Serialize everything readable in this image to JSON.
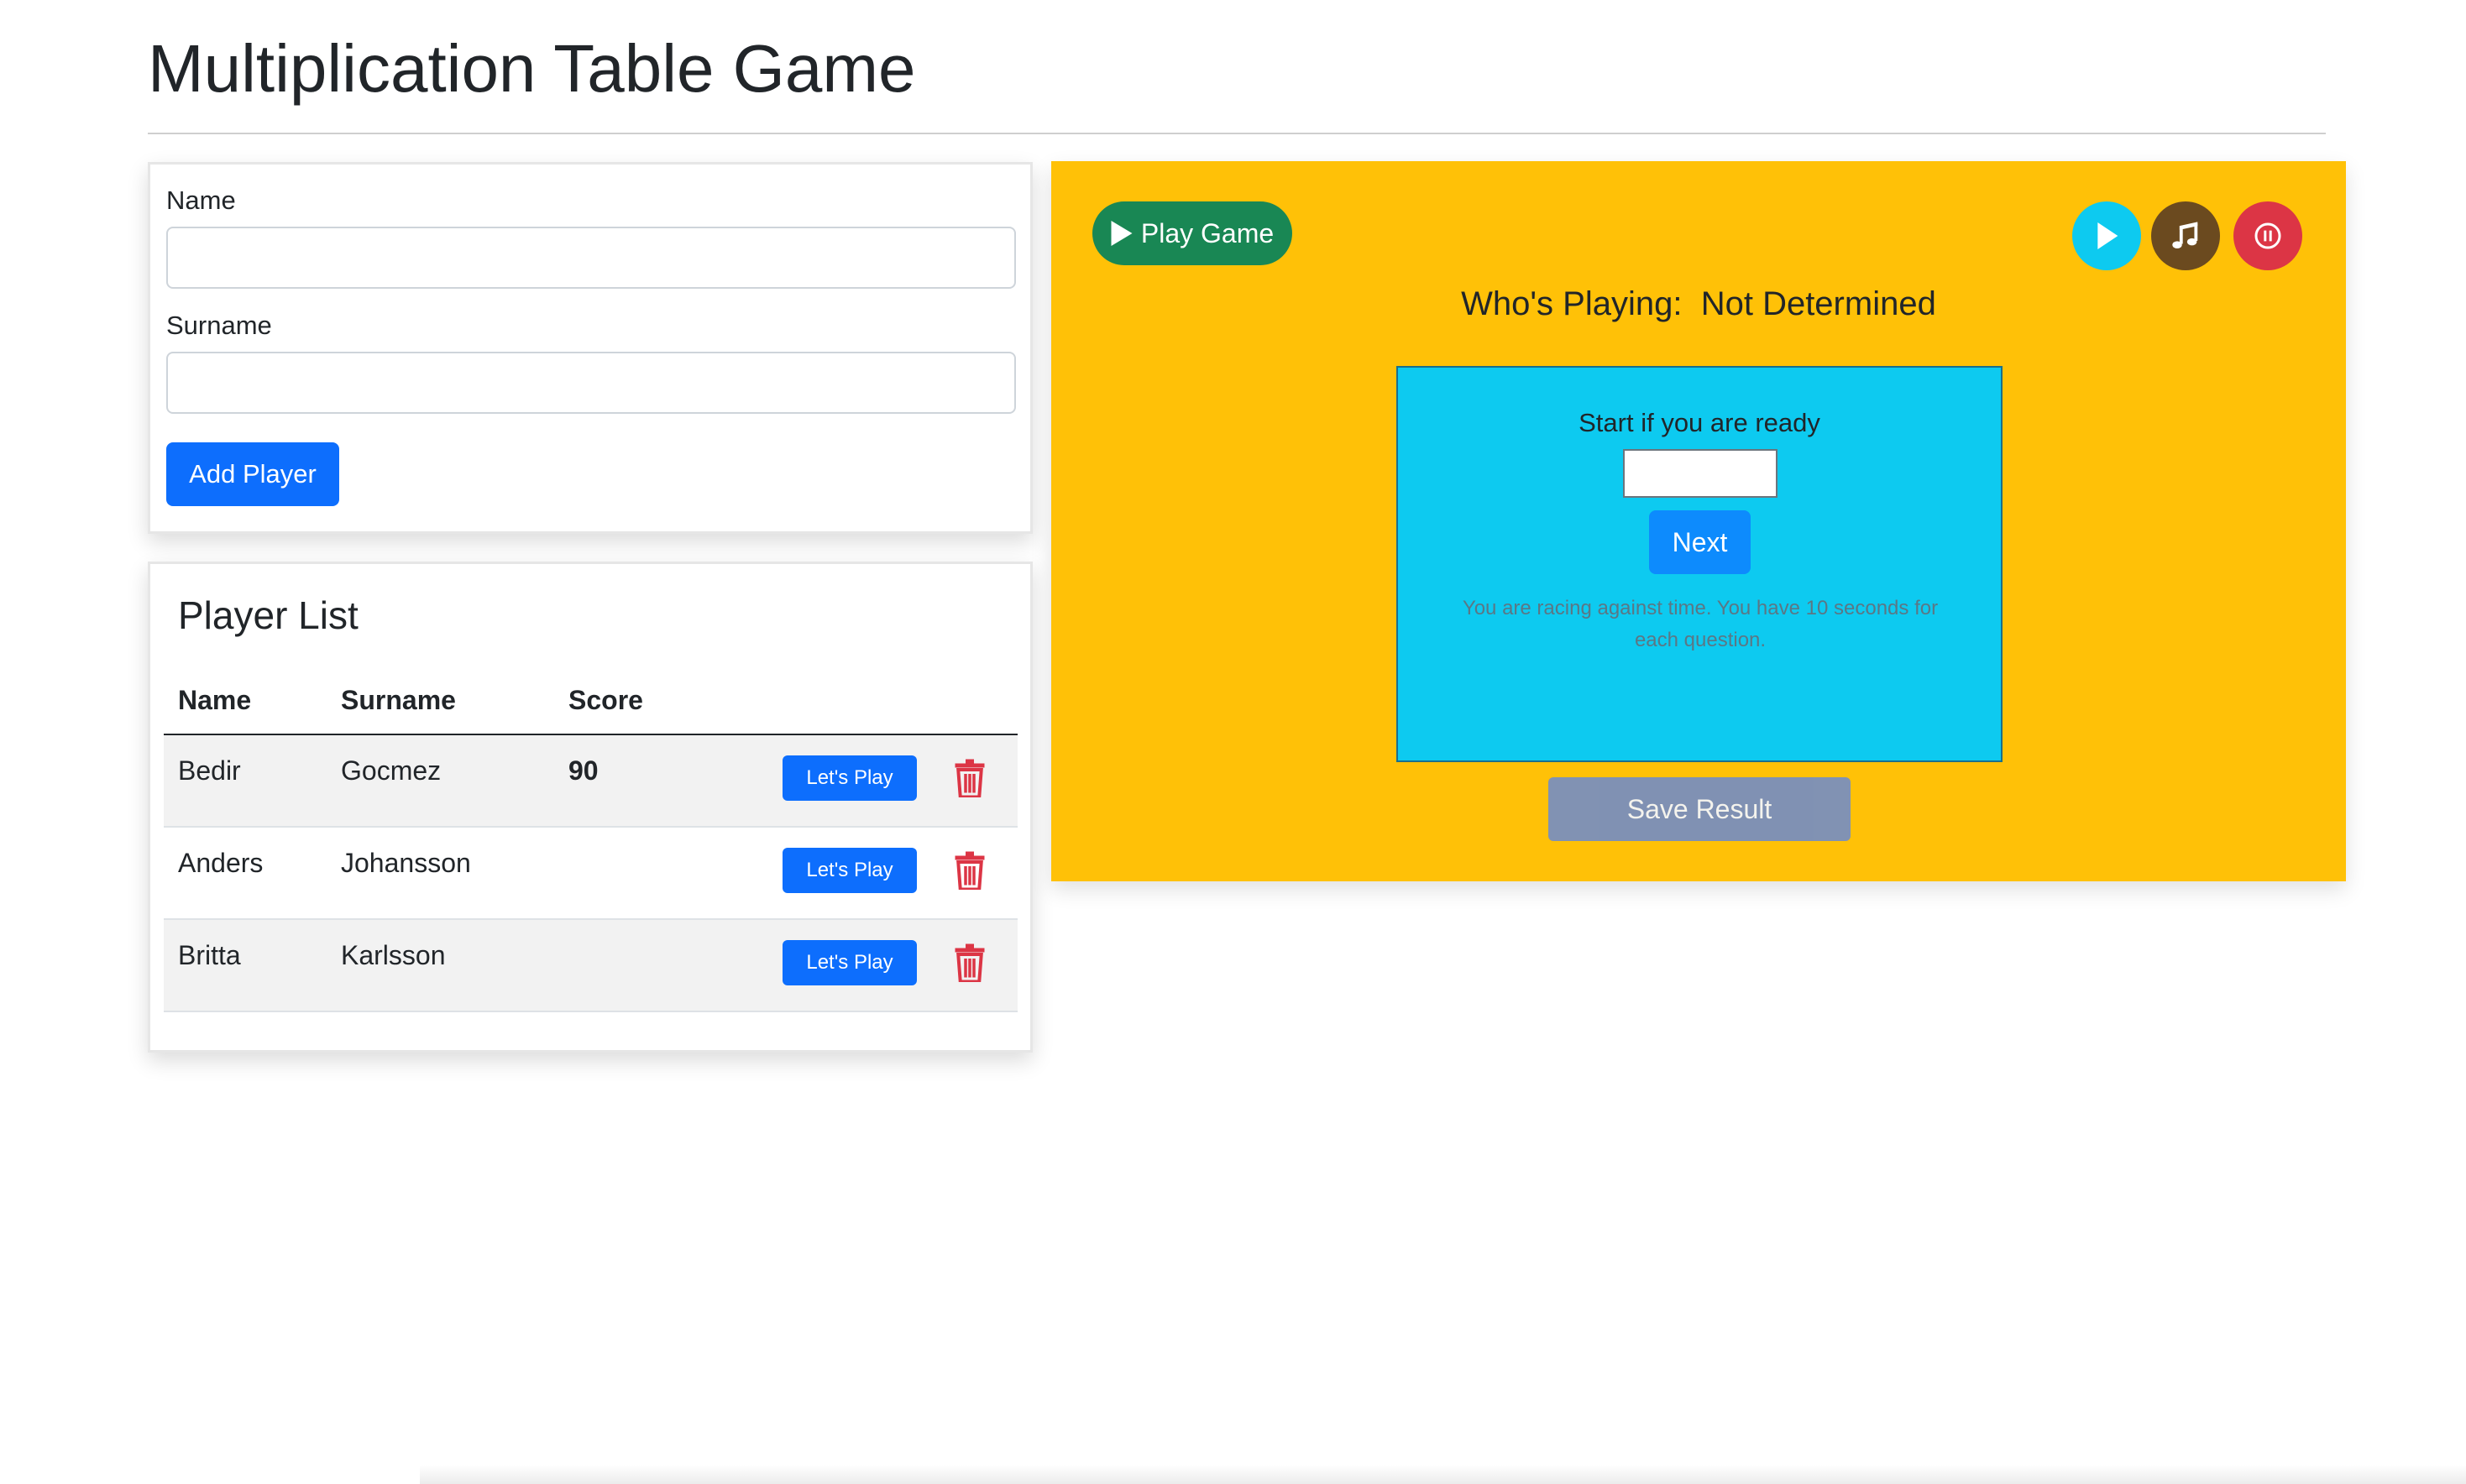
{
  "page": {
    "title": "Multiplication Table Game"
  },
  "form": {
    "name_label": "Name",
    "name_value": "",
    "surname_label": "Surname",
    "surname_value": "",
    "add_button": "Add Player"
  },
  "player_list": {
    "title": "Player List",
    "columns": [
      "Name",
      "Surname",
      "Score"
    ],
    "rows": [
      {
        "name": "Bedir",
        "surname": "Gocmez",
        "score": "90",
        "play_label": "Let's Play"
      },
      {
        "name": "Anders",
        "surname": "Johansson",
        "score": "",
        "play_label": "Let's Play"
      },
      {
        "name": "Britta",
        "surname": "Karlsson",
        "score": "",
        "play_label": "Let's Play"
      }
    ]
  },
  "game": {
    "play_button": "Play Game",
    "playing_label": "Who's Playing:",
    "playing_value": "Not Determined",
    "prompt": "Start if you are ready",
    "answer_value": "",
    "next_button": "Next",
    "note": "You are racing against time. You have 10 seconds for each question.",
    "save_button": "Save Result"
  },
  "icons": {
    "play_game": "play-icon",
    "circle_play": "play-icon",
    "music": "music-note-icon",
    "pause": "pause-icon",
    "delete": "trash-icon"
  },
  "colors": {
    "primary": "#0d6efd",
    "success": "#198754",
    "warning": "#ffc107",
    "info": "#0dcaf0",
    "danger": "#dc3545",
    "music_button": "#6b4a1f"
  }
}
